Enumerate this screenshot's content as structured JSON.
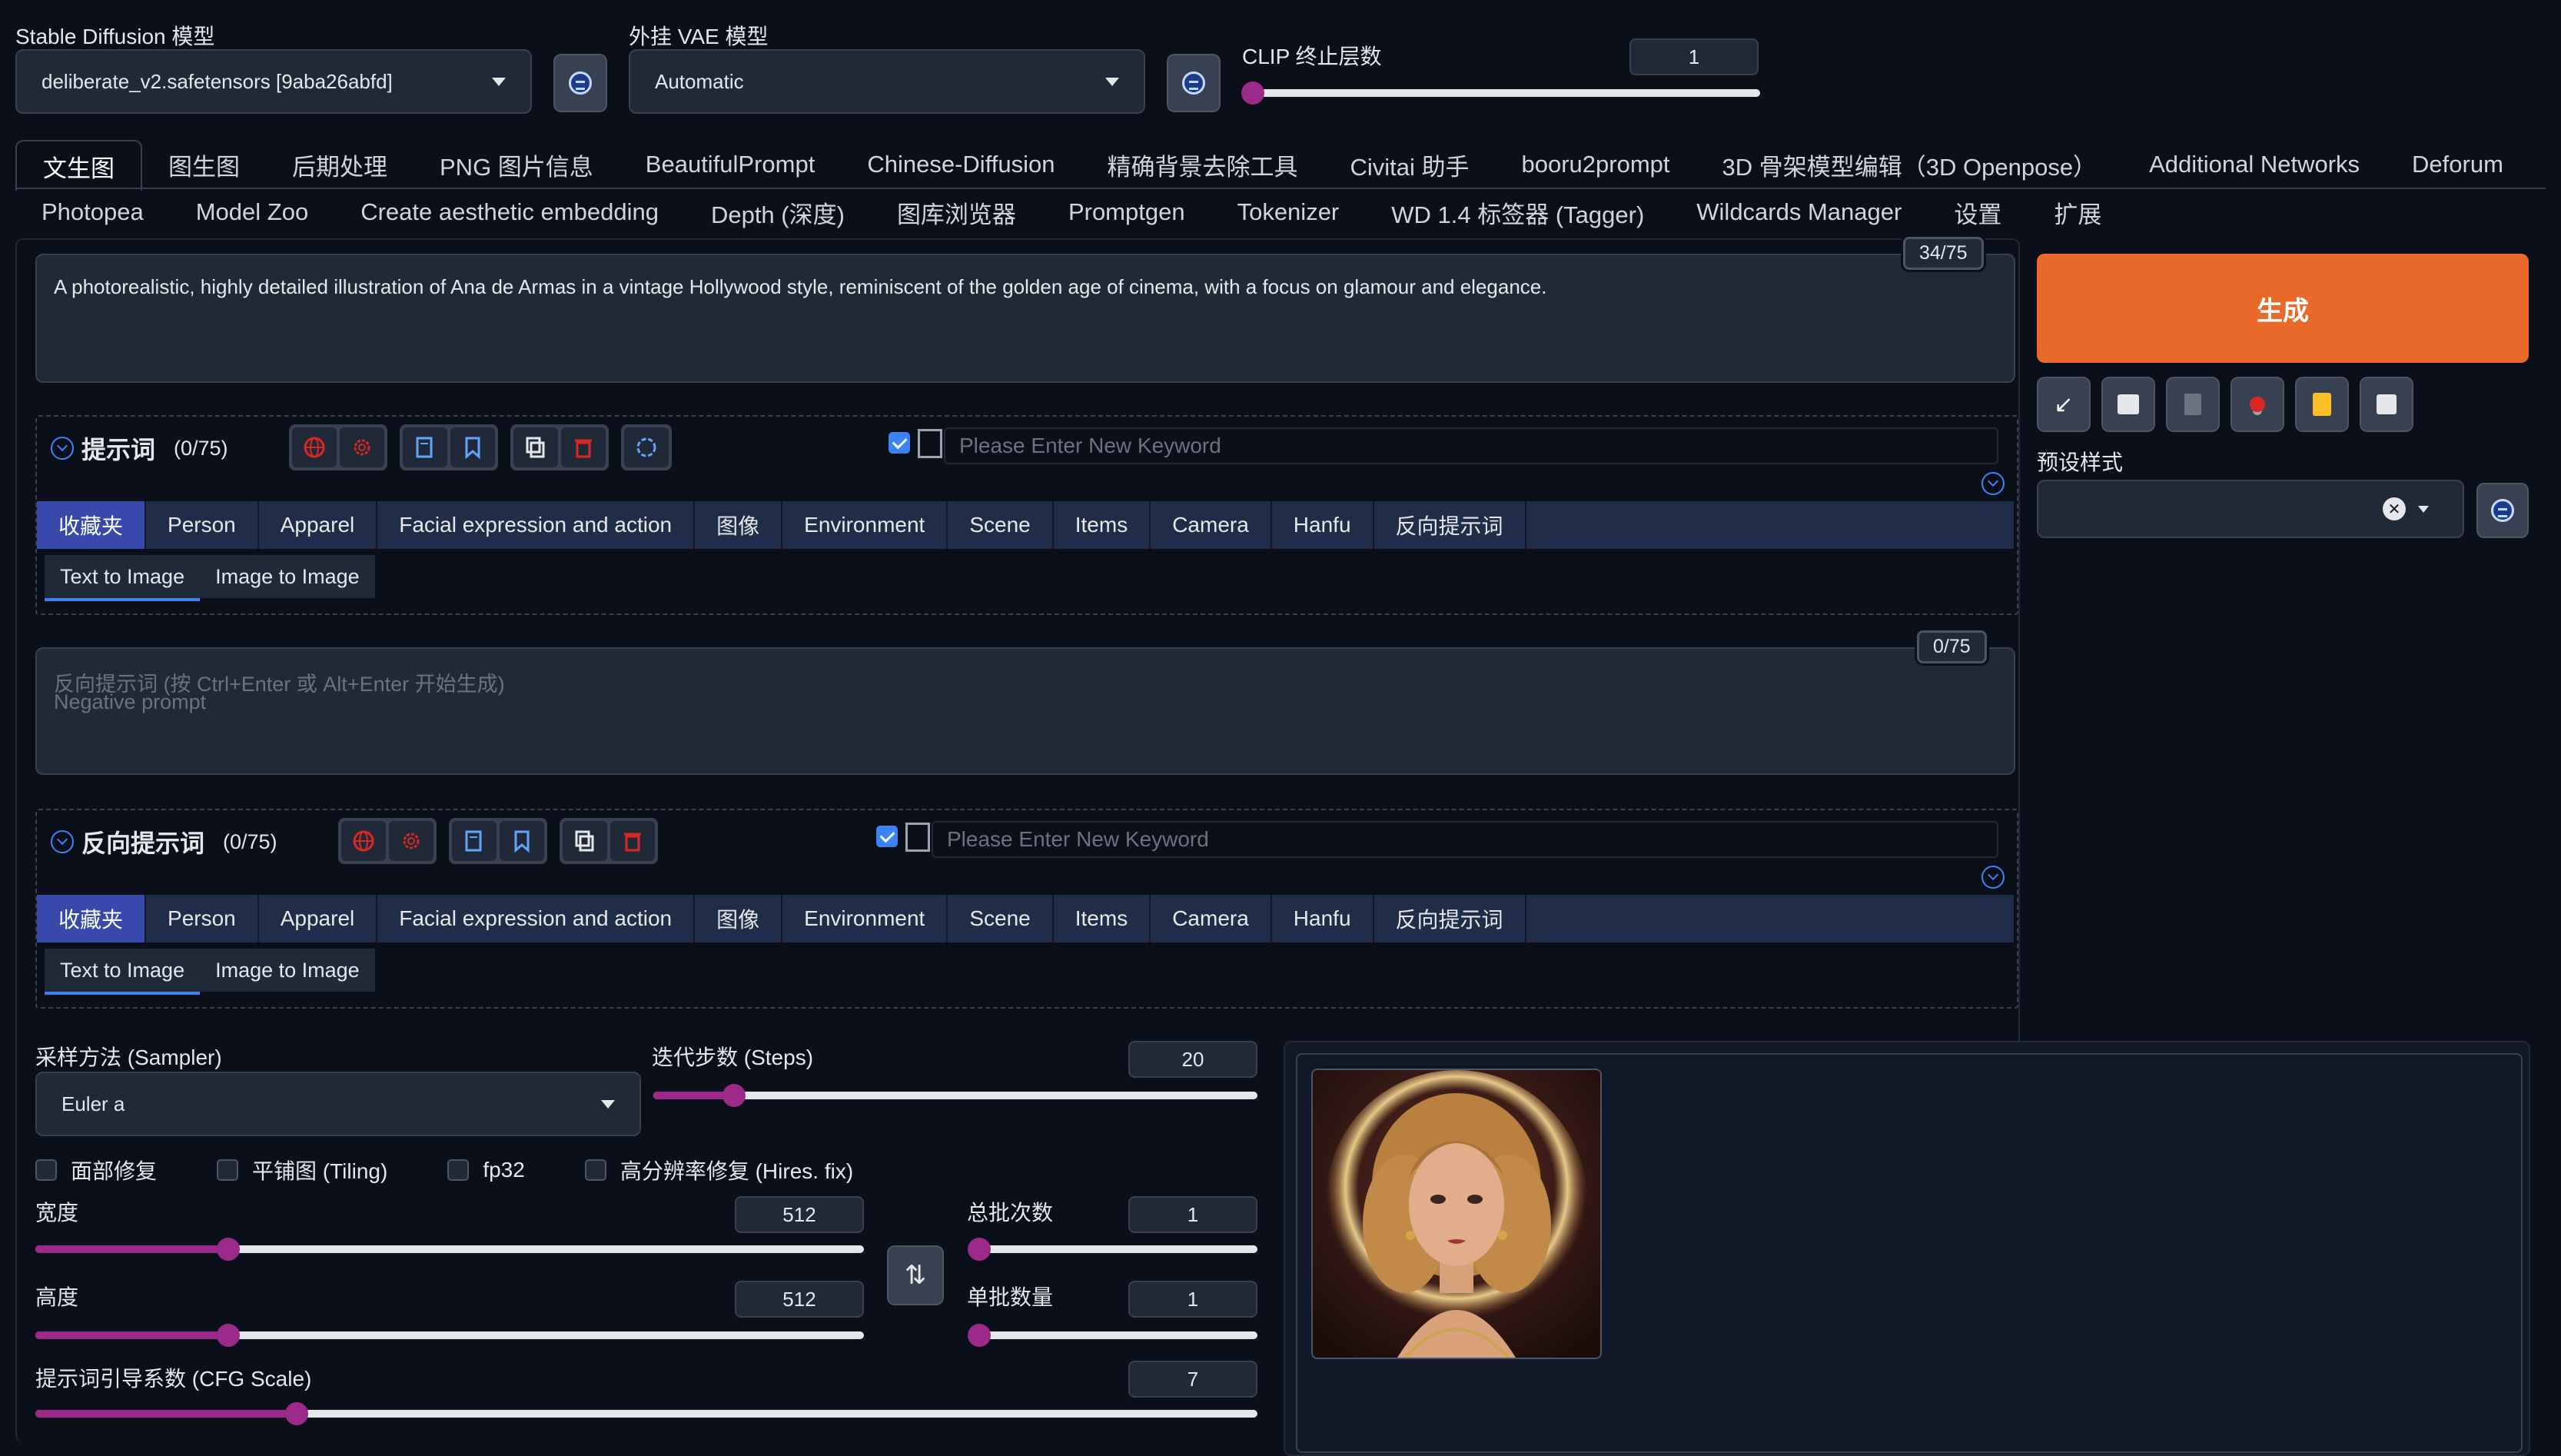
{
  "models": {
    "sd_label": "Stable Diffusion 模型",
    "sd_value": "deliberate_v2.safetensors [9aba26abfd]",
    "vae_label": "外挂 VAE 模型",
    "vae_value": "Automatic",
    "clip_label": "CLIP 终止层数",
    "clip_value": "1"
  },
  "tabs_row1": [
    "文生图",
    "图生图",
    "后期处理",
    "PNG 图片信息",
    "BeautifulPrompt",
    "Chinese-Diffusion",
    "精确背景去除工具",
    "Civitai 助手",
    "booru2prompt",
    "3D 骨架模型编辑（3D Openpose）",
    "Additional Networks",
    "Deforum"
  ],
  "tabs_row2": [
    "Photopea",
    "Model Zoo",
    "Create aesthetic embedding",
    "Depth (深度)",
    "图库浏览器",
    "Promptgen",
    "Tokenizer",
    "WD 1.4 标签器 (Tagger)",
    "Wildcards Manager",
    "设置",
    "扩展"
  ],
  "prompt": {
    "text": "A photorealistic, highly detailed illustration of Ana de Armas in a vintage Hollywood style, reminiscent of the golden age of cinema, with a focus on glamour and elegance.",
    "counter": "34/75"
  },
  "generate_label": "生成",
  "preset": {
    "label": "预设样式",
    "close": "✕"
  },
  "tag_panel_pos": {
    "title": "提示词",
    "count": "(0/75)",
    "placeholder": "Please Enter New Keyword"
  },
  "tag_panel_neg": {
    "title": "反向提示词",
    "count": "(0/75)",
    "placeholder": "Please Enter New Keyword"
  },
  "categories": [
    "收藏夹",
    "Person",
    "Apparel",
    "Facial expression and action",
    "图像",
    "Environment",
    "Scene",
    "Items",
    "Camera",
    "Hanfu",
    "反向提示词"
  ],
  "subtabs": [
    "Text to Image",
    "Image to Image"
  ],
  "negative": {
    "placeholder1": "反向提示词 (按 Ctrl+Enter 或 Alt+Enter 开始生成)",
    "placeholder2": "Negative prompt",
    "counter": "0/75"
  },
  "sampler": {
    "label": "采样方法 (Sampler)",
    "value": "Euler a"
  },
  "steps": {
    "label": "迭代步数 (Steps)",
    "value": "20",
    "fraction": 0.133
  },
  "checkboxes": [
    "面部修复",
    "平铺图 (Tiling)",
    "fp32",
    "高分辨率修复 (Hires. fix)"
  ],
  "width": {
    "label": "宽度",
    "value": "512",
    "fraction": 0.233
  },
  "height": {
    "label": "高度",
    "value": "512",
    "fraction": 0.233
  },
  "batch_count": {
    "label": "总批次数",
    "value": "1",
    "fraction": 0.0
  },
  "batch_size": {
    "label": "单批数量",
    "value": "1",
    "fraction": 0.0
  },
  "cfg": {
    "label": "提示词引导系数 (CFG Scale)",
    "value": "7",
    "fraction": 0.214
  },
  "clip_fraction": 0.0,
  "colors": {
    "accent": "#9c2a8a",
    "generate": "#e8692a",
    "category_active": "#3949ab"
  }
}
